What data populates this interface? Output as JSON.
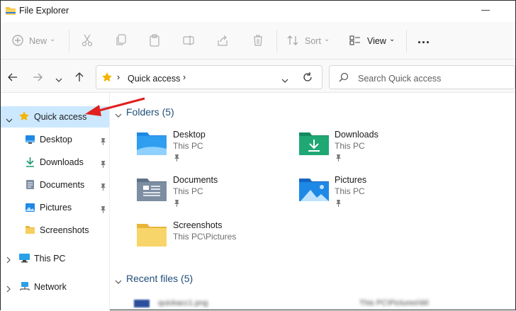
{
  "window": {
    "title": "File Explorer"
  },
  "toolbar": {
    "new_label": "New",
    "sort_label": "Sort",
    "view_label": "View",
    "more_label": "..."
  },
  "address": {
    "breadcrumb": "Quick access",
    "search_placeholder": "Search Quick access"
  },
  "sidebar": {
    "quick_access": "Quick access",
    "items": [
      {
        "label": "Desktop",
        "icon": "desktop-icon",
        "pinned": true
      },
      {
        "label": "Downloads",
        "icon": "downloads-icon",
        "pinned": true
      },
      {
        "label": "Documents",
        "icon": "documents-icon",
        "pinned": true
      },
      {
        "label": "Pictures",
        "icon": "pictures-icon",
        "pinned": true
      },
      {
        "label": "Screenshots",
        "icon": "folder-icon",
        "pinned": false
      }
    ],
    "this_pc": "This PC",
    "network": "Network"
  },
  "content": {
    "folders_header": "Folders (5)",
    "folders": [
      {
        "name": "Desktop",
        "location": "This PC"
      },
      {
        "name": "Downloads",
        "location": "This PC"
      },
      {
        "name": "Documents",
        "location": "This PC"
      },
      {
        "name": "Pictures",
        "location": "This PC"
      },
      {
        "name": "Screenshots",
        "location": "This PC\\Pictures"
      }
    ],
    "recent_header": "Recent files (5)",
    "recent_first": {
      "name": "quickacc1.png",
      "location": "This PC\\Pictures\\Wi"
    }
  },
  "colors": {
    "selection": "#cce8ff",
    "accent_blue": "#0067c0",
    "annotation_arrow": "#e0201e",
    "folder_yellow": "#f5c542"
  }
}
